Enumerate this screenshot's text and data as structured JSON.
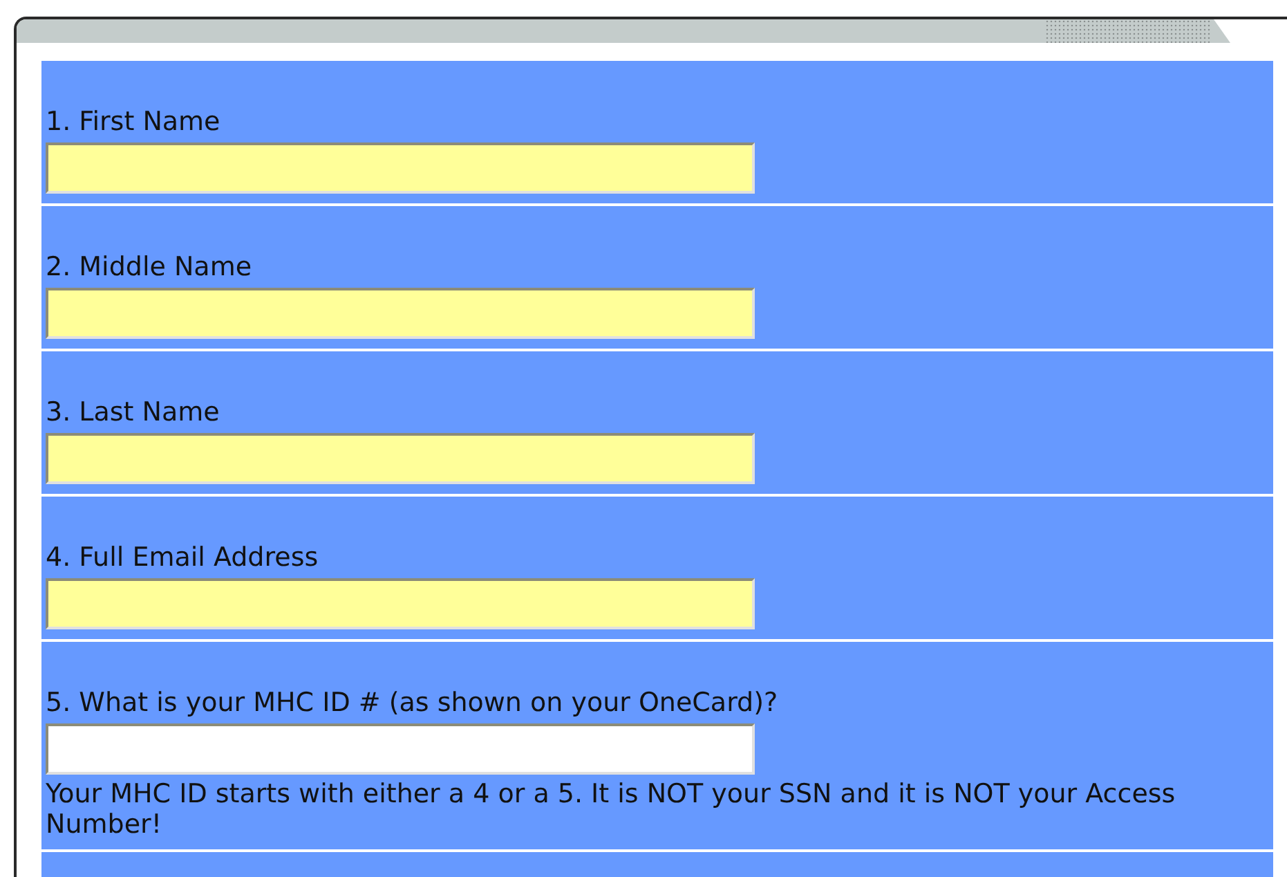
{
  "questions": [
    {
      "label": "1. First Name",
      "required": true
    },
    {
      "label": "2. Middle Name",
      "required": true
    },
    {
      "label": "3. Last Name",
      "required": true
    },
    {
      "label": "4. Full Email Address",
      "required": true
    },
    {
      "label": "5. What is your MHC ID # (as shown on your OneCard)?",
      "required": false,
      "hint": "Your MHC ID starts with either a 4 or a 5. It is NOT your SSN and it is NOT your Access Number!"
    }
  ]
}
